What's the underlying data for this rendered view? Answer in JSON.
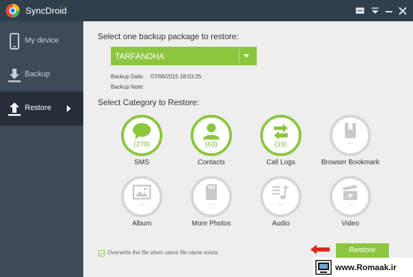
{
  "app": {
    "title": "SyncDroid",
    "accent": "#8cc63f",
    "titlebar_color": "#2f3f4c",
    "sidebar_color": "#3e4a56"
  },
  "window_controls": [
    {
      "name": "chat-icon"
    },
    {
      "name": "menu-dropdown-icon"
    },
    {
      "name": "minimize-icon"
    },
    {
      "name": "close-icon"
    }
  ],
  "sidebar": {
    "items": [
      {
        "label": "My device",
        "icon": "phone-icon",
        "active": false
      },
      {
        "label": "Backup",
        "icon": "download-icon",
        "active": false
      },
      {
        "label": "Restore",
        "icon": "upload-icon",
        "active": true
      }
    ]
  },
  "main": {
    "select_package_title": "Select one backup package to restore:",
    "package": {
      "selected": "TARFANDHA",
      "backup_date_label": "Backup Date:",
      "backup_date": "07/06/2015 18:03:25",
      "backup_note_label": "Backup Note:",
      "backup_note": ""
    },
    "select_category_title": "Select Category to Restore:",
    "categories": [
      {
        "name": "SMS",
        "count": "(279)",
        "icon": "speech-bubble-icon",
        "active": true
      },
      {
        "name": "Contacts",
        "count": "(63)",
        "icon": "person-icon",
        "active": true
      },
      {
        "name": "Call Logs",
        "count": "(19)",
        "icon": "swap-arrows-icon",
        "active": true
      },
      {
        "name": "Browser Bookmark",
        "count": "...",
        "icon": "bookmark-icon",
        "active": false
      },
      {
        "name": "Album",
        "count": "...",
        "icon": "picture-icon",
        "active": false
      },
      {
        "name": "More Photos",
        "count": "...",
        "icon": "sd-card-icon",
        "active": false
      },
      {
        "name": "Audio",
        "count": "...",
        "icon": "music-note-icon",
        "active": false
      },
      {
        "name": "Video",
        "count": "...",
        "icon": "film-play-icon",
        "active": false
      }
    ],
    "overwrite_label": "Overwrite the file when same file name exists",
    "overwrite_checked": true,
    "restore_button": "Restore"
  },
  "watermark": {
    "text": "www.Romaak.ir"
  }
}
